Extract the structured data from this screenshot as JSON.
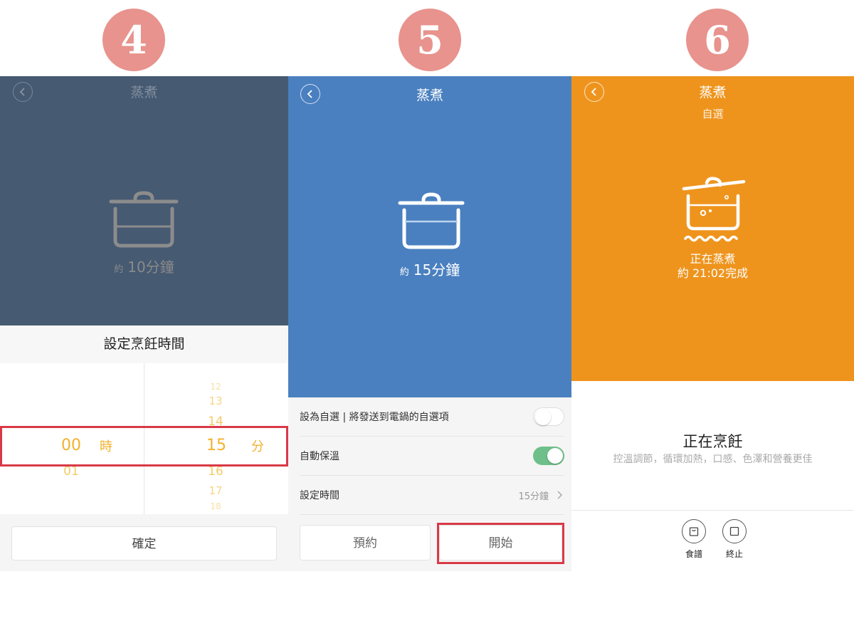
{
  "steps": [
    "4",
    "5",
    "6"
  ],
  "panel1": {
    "title": "蒸煮",
    "duration_prefix": "約",
    "duration_value": "10分鐘",
    "sheet_title": "設定烹飪時間",
    "hours_above": [],
    "hours_below": [
      "01"
    ],
    "minutes_above": [
      "12",
      "13",
      "14"
    ],
    "minutes_below": [
      "16",
      "17",
      "18"
    ],
    "selected_hour": "00",
    "hour_unit": "時",
    "selected_minute": "15",
    "minute_unit": "分",
    "confirm_label": "確定"
  },
  "panel2": {
    "title": "蒸煮",
    "duration_prefix": "約",
    "duration_value": "15分鐘",
    "settings": [
      {
        "label": "設為自選 | 將發送到電鍋的自選項",
        "type": "toggle",
        "on": false
      },
      {
        "label": "自動保溫",
        "type": "toggle",
        "on": true
      },
      {
        "label": "設定時間",
        "type": "value",
        "value": "15分鐘"
      }
    ],
    "reserve_label": "預約",
    "start_label": "開始"
  },
  "panel3": {
    "title": "蒸煮",
    "subtitle": "自選",
    "status_line1": "正在蒸煮",
    "status_line2": "約 21:02完成",
    "status_title": "正在烹飪",
    "status_desc": "控溫調節，循環加熱，口感、色澤和營養更佳",
    "recipe_label": "食譜",
    "stop_label": "終止"
  },
  "colors": {
    "panel1_hero": "#465a72",
    "panel2_hero": "#4a80c0",
    "panel3_hero": "#ee941d",
    "badge": "#e8938d",
    "highlight_frame": "#d93947",
    "picker_accent": "#f3b12d",
    "toggle_on": "#6fbf8a"
  }
}
